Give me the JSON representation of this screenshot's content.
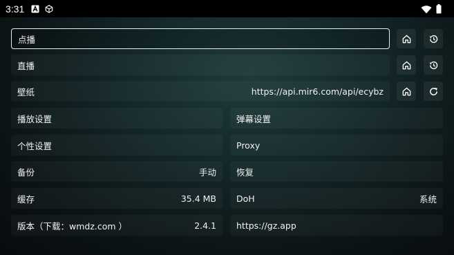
{
  "status_bar": {
    "time": "3:31"
  },
  "rows": {
    "vod": {
      "label": "点播",
      "value": ""
    },
    "live": {
      "label": "直播",
      "value": ""
    },
    "wallpaper": {
      "label": "壁纸",
      "value": "https://api.mir6.com/api/ecybz"
    }
  },
  "settings": {
    "playback": {
      "label": "播放设置"
    },
    "danmaku": {
      "label": "弹幕设置"
    },
    "personal": {
      "label": "个性设置"
    },
    "proxy": {
      "label": "Proxy"
    },
    "backup": {
      "label": "备份",
      "value": "手动"
    },
    "restore": {
      "label": "恢复"
    },
    "cache": {
      "label": "缓存",
      "value": "35.4 MB"
    },
    "doh": {
      "label": "DoH",
      "value": "系统"
    },
    "version": {
      "label": "版本（下载：wmdz.com ）",
      "value": "2.4.1"
    },
    "site": {
      "label": "https://gz.app"
    }
  },
  "icons": {
    "home": "home-icon",
    "history": "history-icon",
    "refresh": "refresh-icon"
  }
}
